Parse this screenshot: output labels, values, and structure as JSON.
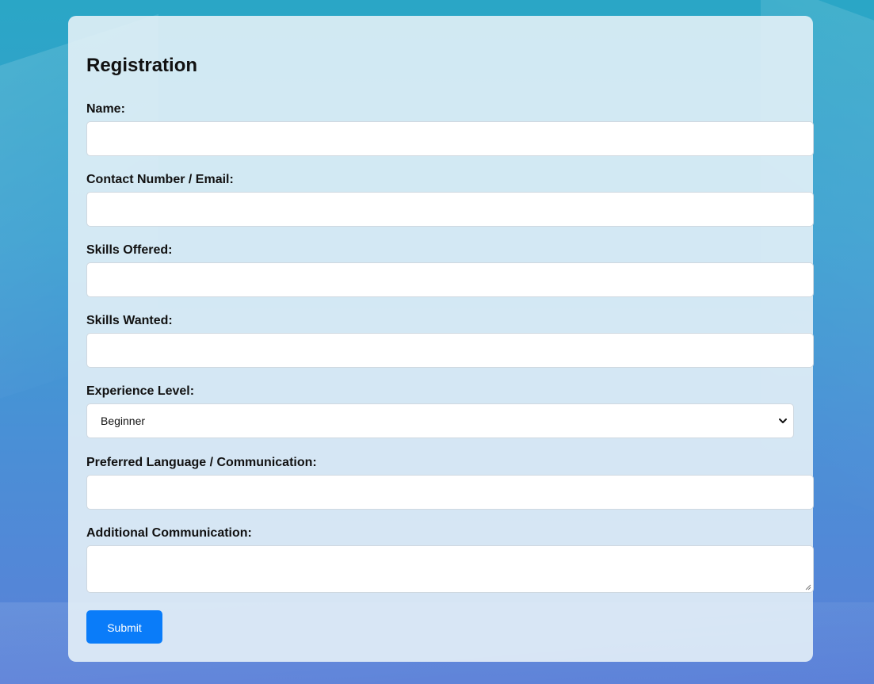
{
  "form": {
    "title": "Registration",
    "fields": [
      {
        "label": "Name:",
        "value": "",
        "placeholder": ""
      },
      {
        "label": "Contact Number / Email:",
        "value": "",
        "placeholder": ""
      },
      {
        "label": "Skills Offered:",
        "value": "",
        "placeholder": ""
      },
      {
        "label": "Skills Wanted:",
        "value": "",
        "placeholder": ""
      }
    ],
    "experience": {
      "label": "Experience Level:",
      "selected": "Beginner"
    },
    "language": {
      "label": "Preferred Language / Communication:",
      "value": "",
      "placeholder": ""
    },
    "additional": {
      "label": "Additional Communication:",
      "value": ""
    },
    "submit_label": "Submit"
  },
  "colors": {
    "accent": "#0a7cf9",
    "card_background": "#e8f2f8",
    "page_gradient_top": "#2aa6c6",
    "page_gradient_bottom": "#5b80d8"
  },
  "icons": {
    "select_arrow": "chevron-down-icon",
    "textarea_grip": "resize-grip-icon"
  }
}
